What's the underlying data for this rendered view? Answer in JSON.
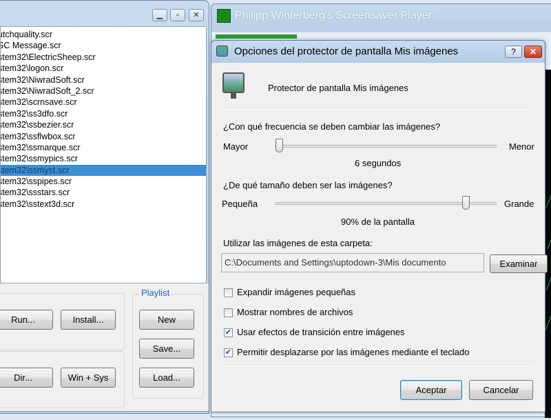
{
  "left_window": {
    "files": [
      "utchquality.scr",
      "SC Message.scr",
      "stem32\\ElectricSheep.scr",
      "stem32\\logon.scr",
      "stem32\\NiwradSoft.scr",
      "stem32\\NiwradSoft_2.scr",
      "stem32\\scrnsave.scr",
      "stem32\\ss3dfo.scr",
      "stem32\\ssbezier.scr",
      "stem32\\ssflwbox.scr",
      "stem32\\ssmarque.scr",
      "stem32\\ssmypics.scr",
      "stem32\\ssmyst.scr",
      "stem32\\sspipes.scr",
      "stem32\\ssstars.scr",
      "stem32\\sstext3d.scr"
    ],
    "selected_index": 12,
    "buttons": {
      "run": "Run...",
      "install": "Install...",
      "dir": "Dir...",
      "win_sys": "Win + Sys"
    },
    "playlist": {
      "title": "Playlist",
      "new": "New",
      "save": "Save...",
      "load": "Load..."
    }
  },
  "back_window": {
    "title": "Philipp Winterberg's Screensaver Player"
  },
  "dialog": {
    "title": "Opciones del protector de pantalla Mis imágenes",
    "help": "?",
    "header": "Protector de pantalla Mis imágenes",
    "freq": {
      "question": "¿Con qué frecuencia se deben cambiar las imágenes?",
      "min_label": "Mayor",
      "max_label": "Menor",
      "value_text": "6 segundos",
      "position": 0.02
    },
    "size": {
      "question": "¿De qué tamaño deben ser las imágenes?",
      "min_label": "Pequeña",
      "max_label": "Grande",
      "value_text": "90% de la pantalla",
      "position": 0.86
    },
    "folder_label": "Utilizar las imágenes de esta carpeta:",
    "folder_value": "C:\\Documents and Settings\\uptodown-3\\Mis documento",
    "browse": "Examinar",
    "options": [
      {
        "label": "Expandir imágenes pequeñas",
        "checked": false
      },
      {
        "label": "Mostrar nombres de archivos",
        "checked": false
      },
      {
        "label": "Usar efectos de transición entre imágenes",
        "checked": true
      },
      {
        "label": "Permitir desplazarse por las imágenes mediante el teclado",
        "checked": true
      }
    ],
    "ok": "Aceptar",
    "cancel": "Cancelar"
  },
  "colors": {
    "selection": "#3a8fd6",
    "playlist_title": "#1e64b4",
    "close_button": "#d2442c"
  }
}
